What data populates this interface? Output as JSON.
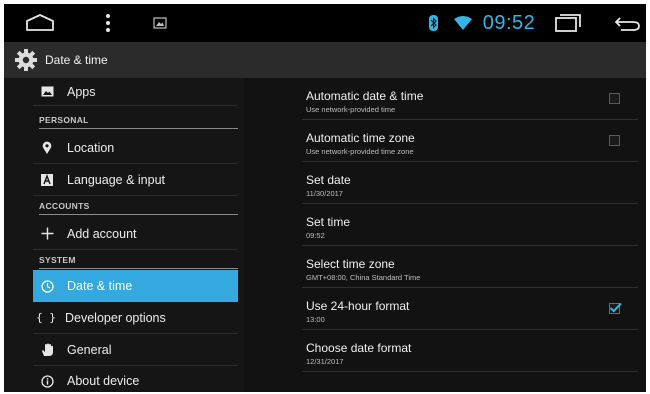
{
  "status_bar": {
    "home_icon": "home-icon",
    "menu_icon": "overflow-menu-icon",
    "gallery_icon": "gallery-icon",
    "bluetooth_icon": "bluetooth-icon",
    "wifi_icon": "wifi-icon",
    "time": "09:52",
    "recents_icon": "recent-apps-icon",
    "back_icon": "back-icon",
    "accent_color": "#33b5e5"
  },
  "action_bar": {
    "icon": "settings-gear-icon",
    "title": "Date & time"
  },
  "sidebar": {
    "active_color": "#33a9e0",
    "items": [
      {
        "type": "item",
        "label": "Apps",
        "icon": "apps-icon"
      },
      {
        "type": "header",
        "label": "PERSONAL"
      },
      {
        "type": "item",
        "label": "Location",
        "icon": "location-pin-icon"
      },
      {
        "type": "item",
        "label": "Language & input",
        "icon": "keyboard-a-icon"
      },
      {
        "type": "header",
        "label": "ACCOUNTS"
      },
      {
        "type": "item",
        "label": "Add account",
        "icon": "plus-icon"
      },
      {
        "type": "header",
        "label": "SYSTEM"
      },
      {
        "type": "item",
        "label": "Date & time",
        "icon": "clock-icon",
        "selected": true
      },
      {
        "type": "item",
        "label": "Developer options",
        "icon": "braces-icon"
      },
      {
        "type": "item",
        "label": "General",
        "icon": "hand-icon"
      },
      {
        "type": "item",
        "label": "About device",
        "icon": "info-icon"
      }
    ]
  },
  "preferences": [
    {
      "title": "Automatic date & time",
      "summary": "Use network-provided time",
      "checkbox": true,
      "checked": false
    },
    {
      "title": "Automatic time zone",
      "summary": "Use network-provided time zone",
      "checkbox": true,
      "checked": false
    },
    {
      "title": "Set date",
      "summary": "11/30/2017",
      "checkbox": false
    },
    {
      "title": "Set time",
      "summary": "09:52",
      "checkbox": false
    },
    {
      "title": "Select time zone",
      "summary": "GMT+08:00, China Standard Time",
      "checkbox": false
    },
    {
      "title": "Use 24-hour format",
      "summary": "13:00",
      "checkbox": true,
      "checked": true
    },
    {
      "title": "Choose date format",
      "summary": "12/31/2017",
      "checkbox": false
    }
  ]
}
